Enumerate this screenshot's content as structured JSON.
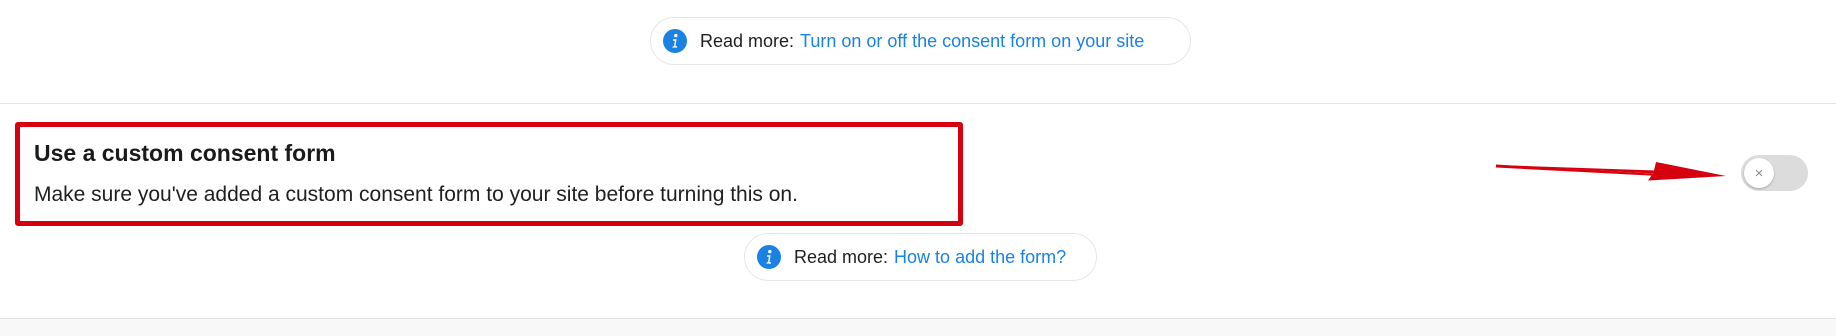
{
  "colors": {
    "link": "#1a82e2",
    "info_icon": "#1a82e2",
    "annotation_red": "#d6000f",
    "toggle_off": "#dcdcdc"
  },
  "read_more_top": {
    "label": "Read more:",
    "link_text": "Turn on or off the consent form on your site",
    "icon": "info-icon"
  },
  "custom_consent": {
    "title": "Use a custom consent form",
    "description": "Make sure you've added a custom consent form to your site before turning this on.",
    "toggle": {
      "state": "off",
      "knob_symbol": "×"
    }
  },
  "read_more_bottom": {
    "label": "Read more:",
    "link_text": "How to add the form?",
    "icon": "info-icon"
  },
  "annotations": {
    "highlight_box": "red-rectangle",
    "arrow": "red-arrow"
  }
}
